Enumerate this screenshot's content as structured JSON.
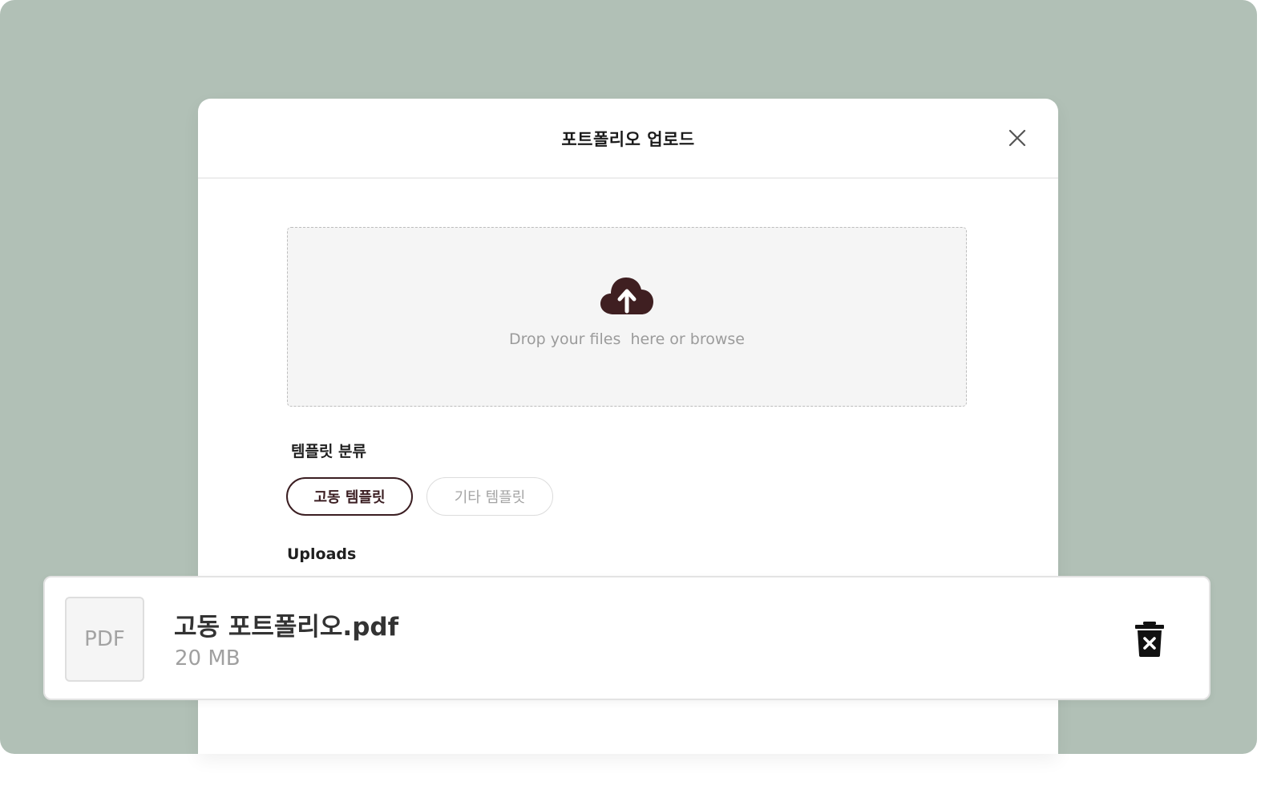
{
  "modal": {
    "title": "포트폴리오 업로드",
    "close_icon": "close-icon"
  },
  "dropzone": {
    "icon": "cloud-upload-icon",
    "text": "Drop your files  here or browse"
  },
  "template": {
    "label": "템플릿 분류",
    "options": [
      {
        "label": "고동 템플릿",
        "selected": true
      },
      {
        "label": "기타 템플릿",
        "selected": false
      }
    ]
  },
  "uploads": {
    "label": "Uploads",
    "files": [
      {
        "type_badge": "PDF",
        "name": "고동 포트폴리오.pdf",
        "size": "20 MB",
        "delete_icon": "trash-x-icon"
      }
    ]
  },
  "colors": {
    "backdrop": "#b1c0b6",
    "accent": "#3b1e22",
    "dropzone_bg": "#f5f5f5",
    "muted_text": "#9b9b9b"
  }
}
